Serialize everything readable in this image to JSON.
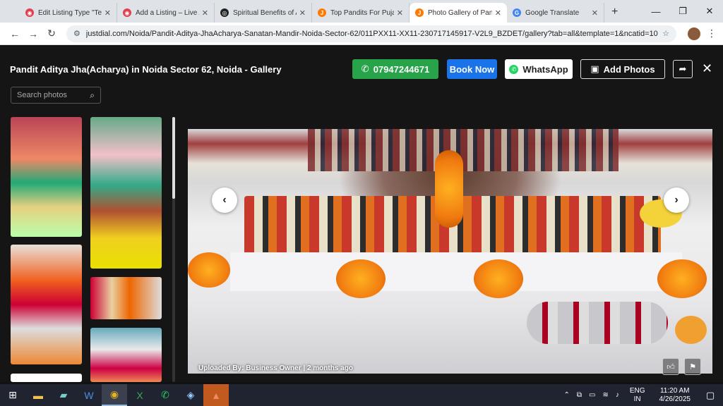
{
  "browser": {
    "tabs": [
      {
        "title": "Edit Listing Type \"Te",
        "favicon_color": "#e04050",
        "active": false
      },
      {
        "title": "Add a Listing – Live A",
        "favicon_color": "#e04050",
        "active": false
      },
      {
        "title": "Spiritual Benefits of A",
        "favicon_color": "#222222",
        "active": false
      },
      {
        "title": "Top Pandits For Puja",
        "favicon_color": "#ff7a00",
        "active": false
      },
      {
        "title": "Photo Gallery of Pand",
        "favicon_color": "#ff7a00",
        "active": true
      },
      {
        "title": "Google Translate",
        "favicon_color": "#4285f4",
        "active": false
      }
    ],
    "new_tab": "+",
    "url": "justdial.com/Noida/Pandit-Aditya-JhaAcharya-Sanatan-Mandir-Noida-Sector-62/011PXX11-XX11-230717145917-V2L9_BZDET/gallery?tab=all&template=1&ncatid=1035192..."
  },
  "gallery": {
    "title": "Pandit Aditya Jha(Acharya) in Noida Sector 62, Noida - Gallery",
    "phone": "07947244671",
    "book_label": "Book Now",
    "whatsapp_label": "WhatsApp",
    "add_photos_label": "Add Photos",
    "search_placeholder": "Search photos",
    "uploaded_by": "Uploaded By: Business Owner | 2 months ago",
    "colors": {
      "call": "#27a34a",
      "book": "#1a73e8"
    }
  },
  "taskbar": {
    "lang_top": "ENG",
    "lang_bottom": "IN",
    "time": "11:20 AM",
    "date": "4/26/2025"
  }
}
